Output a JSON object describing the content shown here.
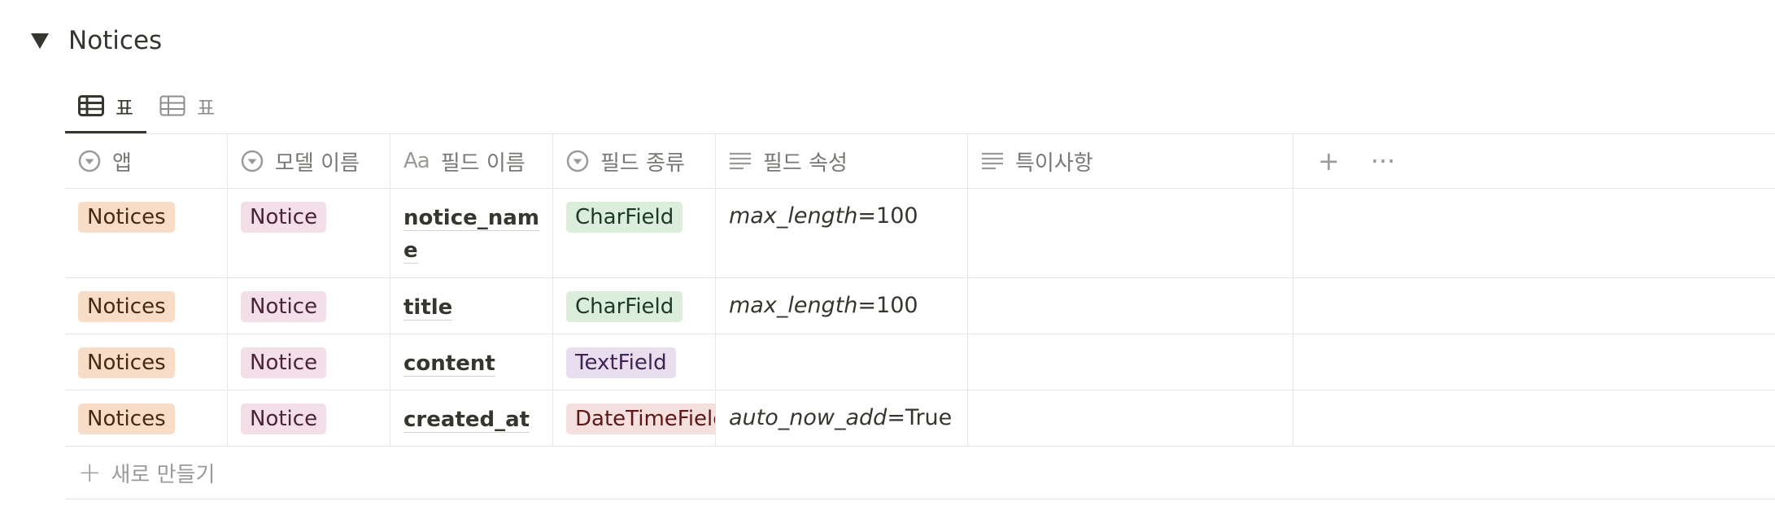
{
  "database": {
    "title": "Notices"
  },
  "tabs": [
    {
      "label": "표",
      "active": true,
      "icon": "table-icon"
    },
    {
      "label": "표",
      "active": false,
      "icon": "table-icon"
    }
  ],
  "columns": [
    {
      "label": "앱",
      "icon": "select-icon"
    },
    {
      "label": "모델 이름",
      "icon": "select-icon"
    },
    {
      "label": "필드 이름",
      "icon": "title-aa-icon",
      "icon_text": "Aa"
    },
    {
      "label": "필드 종류",
      "icon": "select-icon"
    },
    {
      "label": "필드 속성",
      "icon": "text-lines-icon"
    },
    {
      "label": "특이사항",
      "icon": "text-lines-icon"
    }
  ],
  "header_actions": {
    "add": "+",
    "more": "···"
  },
  "rows": [
    {
      "app": "Notices",
      "model": "Notice",
      "field": "notice_name",
      "type": "CharField",
      "type_color": "green",
      "prop_key": "max_length",
      "prop_val": "=100",
      "note": ""
    },
    {
      "app": "Notices",
      "model": "Notice",
      "field": "title",
      "type": "CharField",
      "type_color": "green",
      "prop_key": "max_length",
      "prop_val": "=100",
      "note": ""
    },
    {
      "app": "Notices",
      "model": "Notice",
      "field": "content",
      "type": "TextField",
      "type_color": "purple",
      "prop_key": "",
      "prop_val": "",
      "note": ""
    },
    {
      "app": "Notices",
      "model": "Notice",
      "field": "created_at",
      "type": "DateTimeField",
      "type_color": "red",
      "prop_key": "auto_now_add",
      "prop_val": "=True",
      "note": ""
    }
  ],
  "new_row": {
    "plus": "+",
    "label": "새로 만들기"
  },
  "colors": {
    "tag_orange": "#f7ddc8",
    "tag_pink": "#f2dfe8",
    "tag_green": "#dbeddb",
    "tag_purple": "#e8deee",
    "tag_red": "#f5e0e0",
    "text": "#37352f",
    "muted": "#787774"
  }
}
